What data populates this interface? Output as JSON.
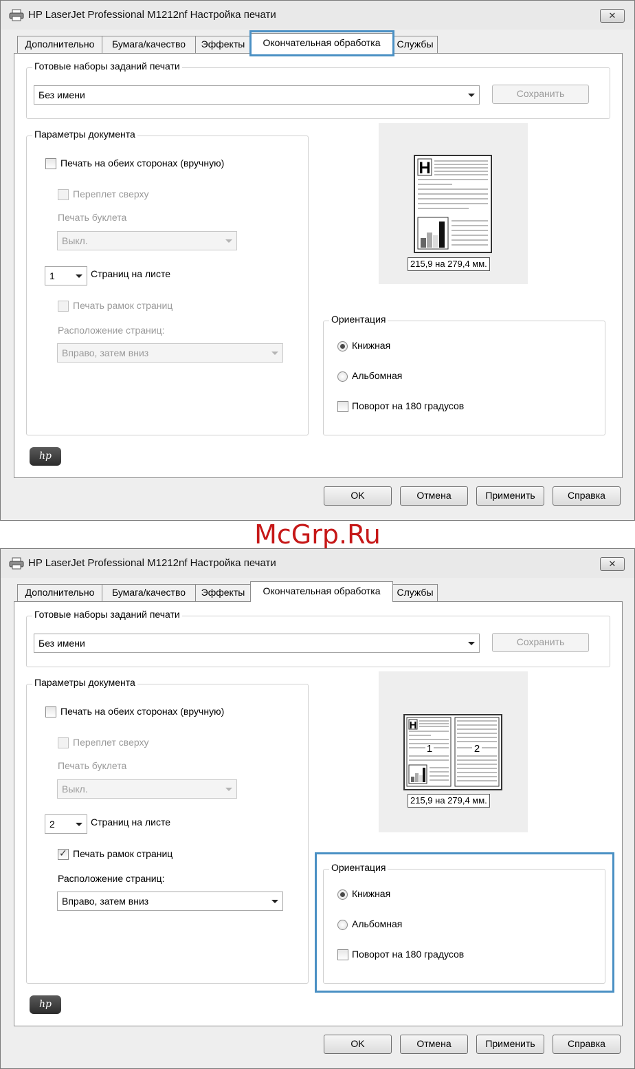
{
  "watermark": "McGrp.Ru",
  "colors": {
    "highlight": "#4a90c4",
    "watermark": "#c61818"
  },
  "dialogs": [
    {
      "title": "HP LaserJet Professional M1212nf Настройка печати",
      "close_glyph": "✕",
      "tabs": [
        "Дополнительно",
        "Бумага/качество",
        "Эффекты",
        "Окончательная обработка",
        "Службы"
      ],
      "active_tab": "Окончательная обработка",
      "presets": {
        "legend": "Готовые наборы заданий печати",
        "value": "Без имени",
        "save_button": "Сохранить"
      },
      "doc_params": {
        "legend": "Параметры документа",
        "duplex_label": "Печать на обеих сторонах (вручную)",
        "flip_up_label": "Переплет сверху",
        "booklet_label": "Печать буклета",
        "booklet_value": "Выкл.",
        "pages_per_sheet_value": "1",
        "pages_per_sheet_label": "Страниц на листе",
        "borders_label": "Печать рамок страниц",
        "borders_checked": false,
        "order_label": "Расположение страниц:",
        "order_value": "Вправо, затем вниз"
      },
      "preview": {
        "dimensions": "215,9 на 279,4 мм."
      },
      "orientation": {
        "legend": "Ориентация",
        "portrait": "Книжная",
        "landscape": "Альбомная",
        "rotate": "Поворот на 180 градусов",
        "selected": "portrait"
      },
      "logo": "hp",
      "buttons": {
        "ok": "OK",
        "cancel": "Отмена",
        "apply": "Применить",
        "help": "Справка"
      },
      "highlight": "tab"
    },
    {
      "title": "HP LaserJet Professional M1212nf Настройка печати",
      "close_glyph": "✕",
      "tabs": [
        "Дополнительно",
        "Бумага/качество",
        "Эффекты",
        "Окончательная обработка",
        "Службы"
      ],
      "active_tab": "Окончательная обработка",
      "presets": {
        "legend": "Готовые наборы заданий печати",
        "value": "Без имени",
        "save_button": "Сохранить"
      },
      "doc_params": {
        "legend": "Параметры документа",
        "duplex_label": "Печать на обеих сторонах (вручную)",
        "flip_up_label": "Переплет сверху",
        "booklet_label": "Печать буклета",
        "booklet_value": "Выкл.",
        "pages_per_sheet_value": "2",
        "pages_per_sheet_label": "Страниц на листе",
        "borders_label": "Печать рамок страниц",
        "borders_checked": true,
        "order_label": "Расположение страниц:",
        "order_value": "Вправо, затем вниз"
      },
      "preview": {
        "dimensions": "215,9 на 279,4 мм.",
        "page_numbers": [
          "1",
          "2"
        ]
      },
      "orientation": {
        "legend": "Ориентация",
        "portrait": "Книжная",
        "landscape": "Альбомная",
        "rotate": "Поворот на 180 градусов",
        "selected": "portrait"
      },
      "logo": "hp",
      "buttons": {
        "ok": "OK",
        "cancel": "Отмена",
        "apply": "Применить",
        "help": "Справка"
      },
      "highlight": "orientation"
    }
  ]
}
